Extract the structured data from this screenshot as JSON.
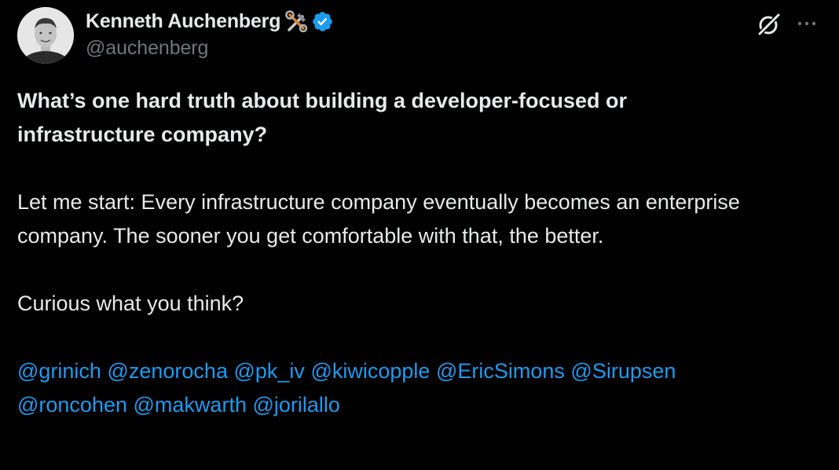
{
  "author": {
    "display_name": "Kenneth Auchenberg",
    "handle": "@auchenberg",
    "verified": true,
    "name_emoji": "hammer-and-wrench-icon",
    "verified_color": "#1d9bf0"
  },
  "tweet": {
    "question": "What’s one hard truth about building a developer-focused or infrastructure company?",
    "paragraph": "Let me start: Every infrastructure company eventually becomes an enterprise company. The sooner you get comfortable with that, the better.",
    "closing": "Curious what you think?",
    "mentions": [
      "@grinich",
      "@zenorocha",
      "@pk_iv",
      "@kiwicopple",
      "@EricSimons",
      "@Sirupsen",
      "@roncohen",
      "@makwarth",
      "@jorilallo"
    ]
  },
  "colors": {
    "background": "#000000",
    "text": "#e7e9ea",
    "secondary_text": "#71767b",
    "link": "#1d9bf0"
  }
}
